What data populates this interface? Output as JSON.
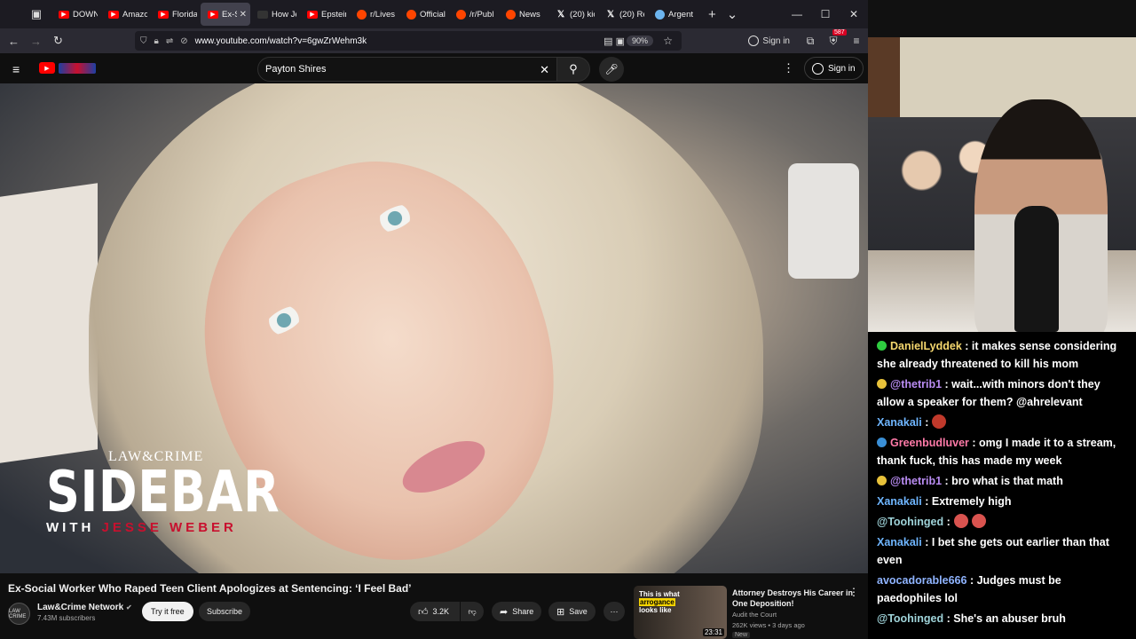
{
  "browser": {
    "tabs": [
      {
        "label": "DOWN",
        "icon": "youtube-icon"
      },
      {
        "label": "Amazo",
        "icon": "youtube-icon"
      },
      {
        "label": "Florida",
        "icon": "youtube-icon"
      },
      {
        "label": "Ex-S",
        "icon": "youtube-icon",
        "active": true
      },
      {
        "label": "How Je",
        "icon": "page-icon"
      },
      {
        "label": "Epstein",
        "icon": "youtube-icon"
      },
      {
        "label": "r/Lives",
        "icon": "reddit-icon"
      },
      {
        "label": "Official",
        "icon": "reddit-icon"
      },
      {
        "label": "/r/Publ",
        "icon": "reddit-icon"
      },
      {
        "label": "News",
        "icon": "reddit-icon"
      },
      {
        "label": "(20) kic",
        "icon": "x-icon"
      },
      {
        "label": "(20) Re",
        "icon": "x-icon"
      },
      {
        "label": "Argent",
        "icon": "flag-icon"
      }
    ],
    "url": "www.youtube.com/watch?v=6gwZrWehm3k",
    "zoom": "90%",
    "signin": "Sign in",
    "badge_count": "587"
  },
  "youtube": {
    "search_value": "Payton Shires",
    "signin": "Sign in",
    "video": {
      "brand_top": "LAW&CRIME",
      "brand_main": "SIDEBAR",
      "brand_with": "WITH",
      "brand_host": "JESSE WEBER"
    },
    "title": "Ex-Social Worker Who Raped Teen Client Apologizes at Sentencing: ‘I Feel Bad’",
    "channel": {
      "name": "Law&Crime Network",
      "subs": "7.43M subscribers",
      "avatar_text": "LAW CRIME"
    },
    "buttons": {
      "try_free": "Try it free",
      "subscribe": "Subscribe",
      "likes": "3.2K",
      "share": "Share",
      "save": "Save"
    },
    "recommended": {
      "thumb_text_1": "This is what",
      "thumb_text_2": "arrogance",
      "thumb_text_3": "looks like",
      "duration": "23:31",
      "title": "Attorney Destroys His Career in One Deposition!",
      "channel": "Audit the Court",
      "meta": "262K views • 3 days ago",
      "badge": "New"
    }
  },
  "chat": {
    "messages": [
      {
        "user": "DanielLyddek",
        "color": "#f5d76e",
        "badge_color": "#2ecc40",
        "text": ": it makes sense considering she already threatened to kill his mom"
      },
      {
        "user": "@thetrib1",
        "color": "#b98cf2",
        "badge_color": "#e8c23a",
        "text": ": wait...with minors don't they allow a speaker for them? @ahrelevant"
      },
      {
        "user": "Xanakali",
        "color": "#6fb6ff",
        "text": ":",
        "emote_color": "#c0392b"
      },
      {
        "user": "Greenbudluver",
        "color": "#ff7aa8",
        "badge_color": "#3a8fd6",
        "text": ": omg I made it to a stream, thank fuck, this has made my week"
      },
      {
        "user": "@thetrib1",
        "color": "#b98cf2",
        "badge_color": "#e8c23a",
        "text": ": bro what is that math"
      },
      {
        "user": "Xanakali",
        "color": "#6fb6ff",
        "text": ": Extremely high"
      },
      {
        "user": "@Toohinged",
        "color": "#9fd3d9",
        "text": ":",
        "emote_color": "#d9534f",
        "emote2_color": "#d9534f"
      },
      {
        "user": "Xanakali",
        "color": "#6fb6ff",
        "text": ": I bet she gets out earlier than that even"
      },
      {
        "user": "avocadorable666",
        "color": "#8fb4ff",
        "text": ": Judges must be paedophiles lol"
      },
      {
        "user": "@Toohinged",
        "color": "#9fd3d9",
        "text": ": She's an abuser bruh"
      }
    ]
  }
}
